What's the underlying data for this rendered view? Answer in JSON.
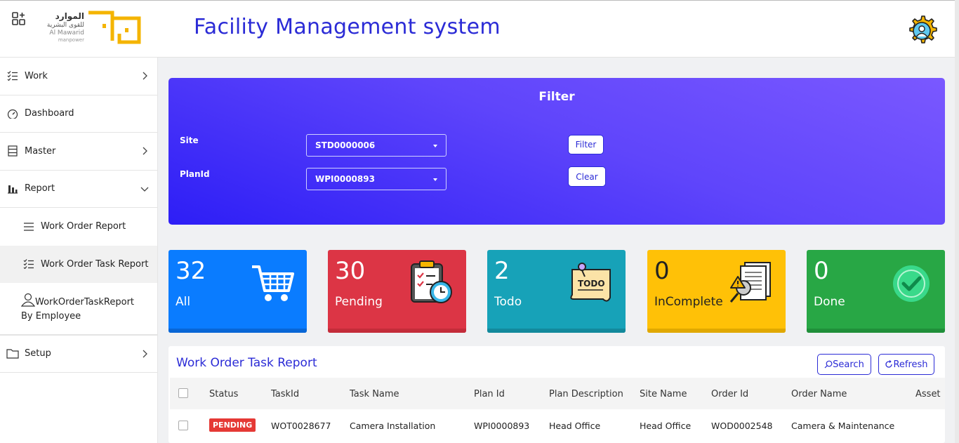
{
  "header": {
    "logo_arabic_line1": "الموارد",
    "logo_arabic_line2": "للقوى البشرية",
    "logo_english": "Al Mawarid",
    "logo_english_sub": "manpower",
    "title": "Facility Management system"
  },
  "sidebar": {
    "items": [
      {
        "label": "Work"
      },
      {
        "label": "Dashboard"
      },
      {
        "label": "Master"
      },
      {
        "label": "Report"
      },
      {
        "label": "Work Order Report"
      },
      {
        "label": "Work Order Task Report"
      },
      {
        "label_line1": "WorkOrderTaskReport",
        "label_line2": "By Employee"
      },
      {
        "label": "Setup"
      }
    ]
  },
  "filter": {
    "title": "Filter",
    "site_label": "Site",
    "site_value": "STD0000006",
    "plan_label": "PlanId",
    "plan_value": "WPI0000893",
    "filter_button": "Filter",
    "clear_button": "Clear"
  },
  "cards": [
    {
      "count": "32",
      "label": "All",
      "color": "#0a7cff"
    },
    {
      "count": "30",
      "label": "Pending",
      "color": "#dc3545"
    },
    {
      "count": "2",
      "label": "Todo",
      "color": "#17a2b8"
    },
    {
      "count": "0",
      "label": "InComplete",
      "color": "#ffc107"
    },
    {
      "count": "0",
      "label": "Done",
      "color": "#28a745"
    }
  ],
  "table": {
    "title": "Work Order Task Report",
    "search_button": "Search",
    "refresh_button": "Refresh",
    "columns": [
      "Status",
      "TaskId",
      "Task Name",
      "Plan Id",
      "Plan Description",
      "Site Name",
      "Order Id",
      "Order Name",
      "Asset"
    ],
    "rows": [
      {
        "status": "PENDING",
        "task_id": "WOT0028677",
        "task_name": "Camera Installation",
        "plan_id": "WPI0000893",
        "plan_description": "Head Office",
        "site_name": "Head Office",
        "order_id": "WOD0002548",
        "order_name": "Camera & Maintenance",
        "asset": ""
      }
    ]
  }
}
